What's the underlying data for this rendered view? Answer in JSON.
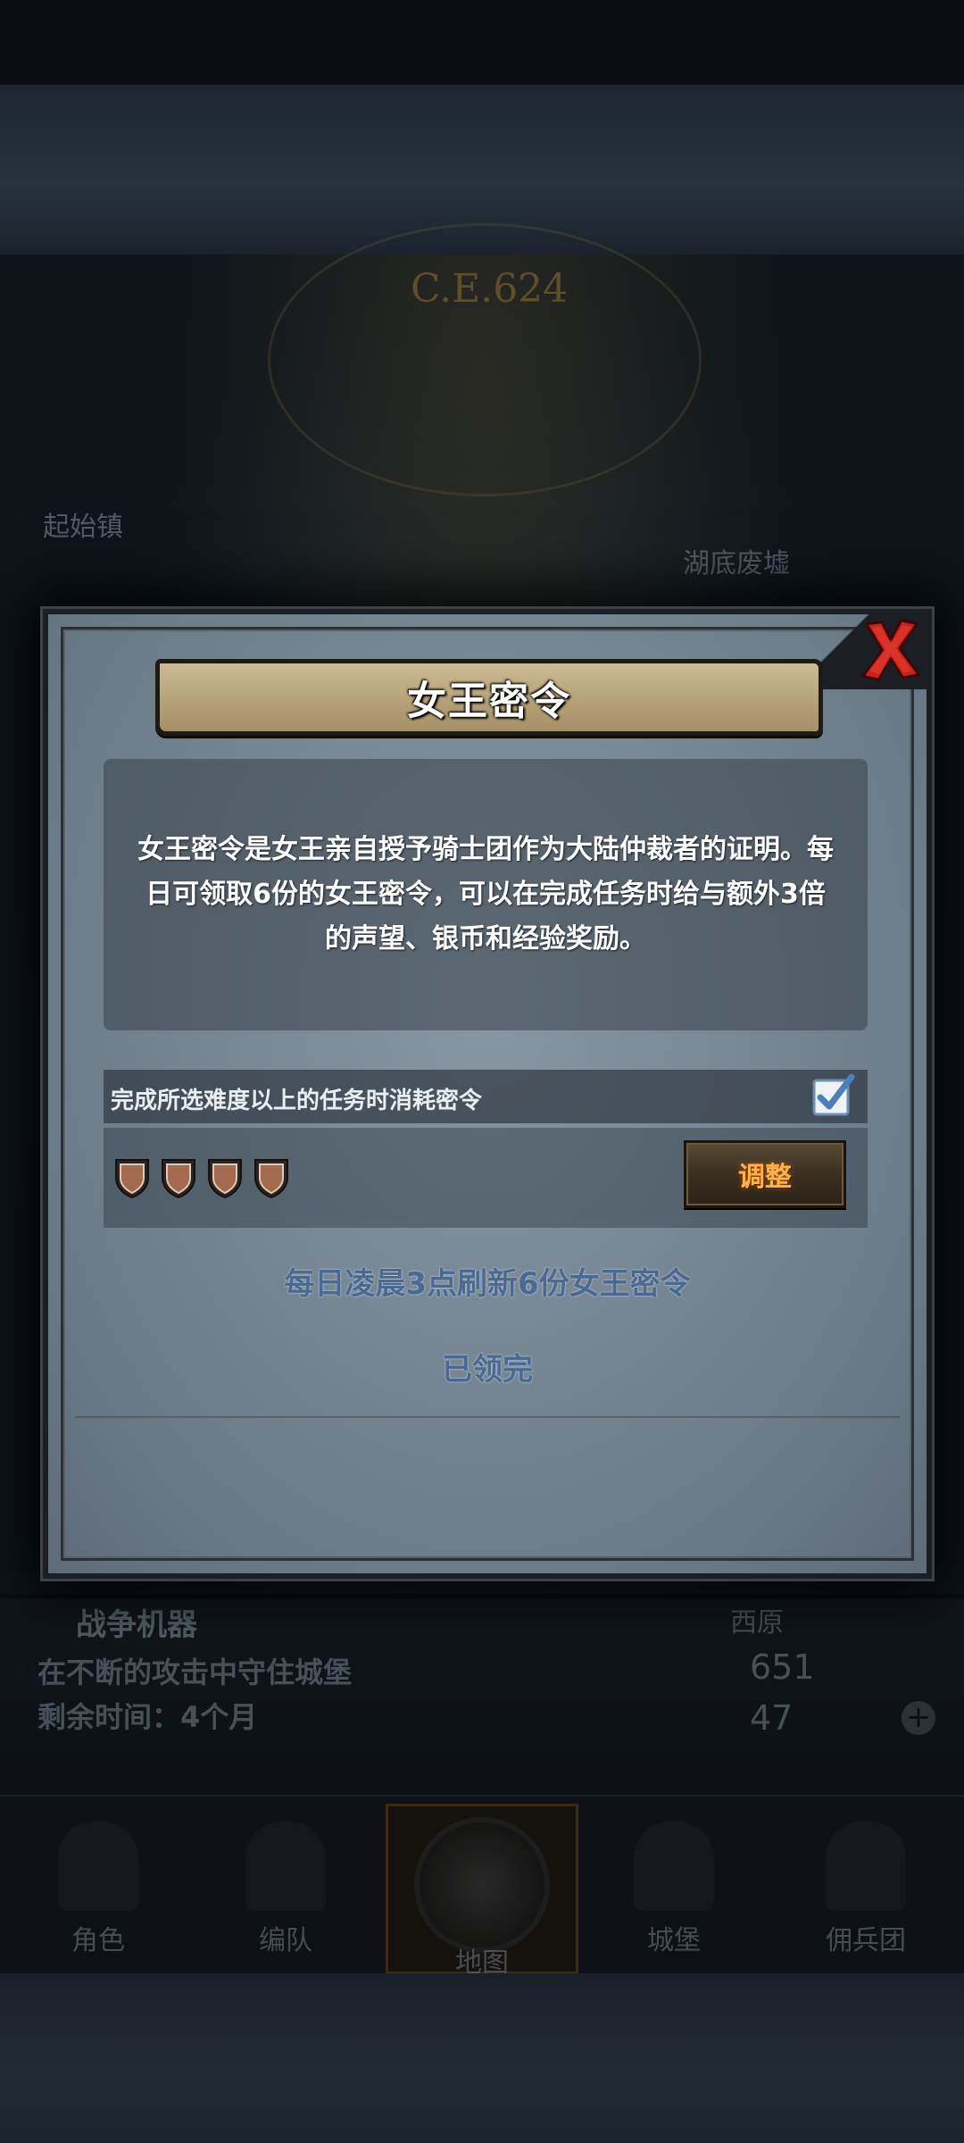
{
  "background": {
    "year_marker": "C.E.624",
    "left_label": "起始镇",
    "right_label": "湖底废墟",
    "event": {
      "title": "战争机器",
      "description": "在不断的攻击中守住城堡",
      "remaining_time": "剩余时间：4个月",
      "region": "西原",
      "stat_1": "651",
      "stat_2": "47"
    },
    "nav": [
      {
        "label": "角色"
      },
      {
        "label": "编队"
      },
      {
        "label": "地图"
      },
      {
        "label": "城堡"
      },
      {
        "label": "佣兵团"
      }
    ],
    "active_nav": "地图"
  },
  "dialog": {
    "title": "女王密令",
    "description": "女王密令是女王亲自授予骑士团作为大陆仲裁者的证明。每日可领取6份的女王密令，可以在完成任务时给与额外3倍的声望、银币和经验奖励。",
    "setting_label": "完成所选难度以上的任务时消耗密令",
    "setting_checked": true,
    "difficulty_shields": 4,
    "adjust_label": "调整",
    "refresh_note": "每日凌晨3点刷新6份女王密令",
    "status": "已领完"
  },
  "colors": {
    "accent_orange": "#ffb24a",
    "close_red": "#c8201c",
    "note_blue": "#4a6a92",
    "panel_gray": "#7e8e9b"
  }
}
